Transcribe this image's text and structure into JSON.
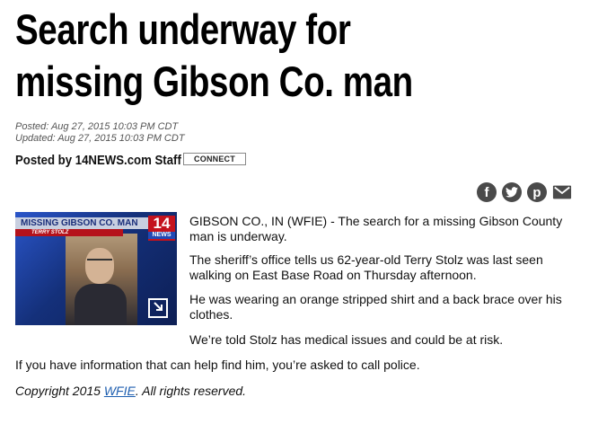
{
  "article": {
    "headline": "Search underway for missing Gibson Co. man",
    "posted": "Posted: Aug 27, 2015 10:03 PM CDT",
    "updated": "Updated: Aug 27, 2015 10:03 PM CDT",
    "byline": "Posted by 14NEWS.com Staff",
    "connect_label": "CONNECT",
    "paragraphs": [
      "GIBSON CO., IN (WFIE) -  The search for a missing Gibson County man is underway.",
      "The sheriff’s office tells us 62-year-old Terry Stolz was last seen walking on East Base Road on Thursday afternoon.",
      "He was wearing an orange stripped shirt and a back brace over his clothes.",
      "We’re told Stolz has medical issues and could be at risk.",
      "If you have information that can help find him, you’re asked to call police."
    ],
    "copyright_prefix": "Copyright 2015 ",
    "copyright_link": "WFIE",
    "copyright_suffix": ". All rights reserved."
  },
  "video_thumbnail": {
    "banner": "MISSING GIBSON CO. MAN",
    "subbanner": "TERRY STOLZ",
    "logo_number": "14",
    "logo_word": "NEWS"
  },
  "share": {
    "buttons": [
      {
        "icon": "facebook-icon",
        "glyph": "f"
      },
      {
        "icon": "twitter-icon",
        "glyph": "t"
      },
      {
        "icon": "pinterest-icon",
        "glyph": "p"
      },
      {
        "icon": "email-icon",
        "glyph": "✉"
      }
    ]
  },
  "colors": {
    "link": "#1f5fb0",
    "share_icon": "#4a4a4a",
    "thumb_blue": "#1c3a8a",
    "logo_red": "#c4121d"
  }
}
